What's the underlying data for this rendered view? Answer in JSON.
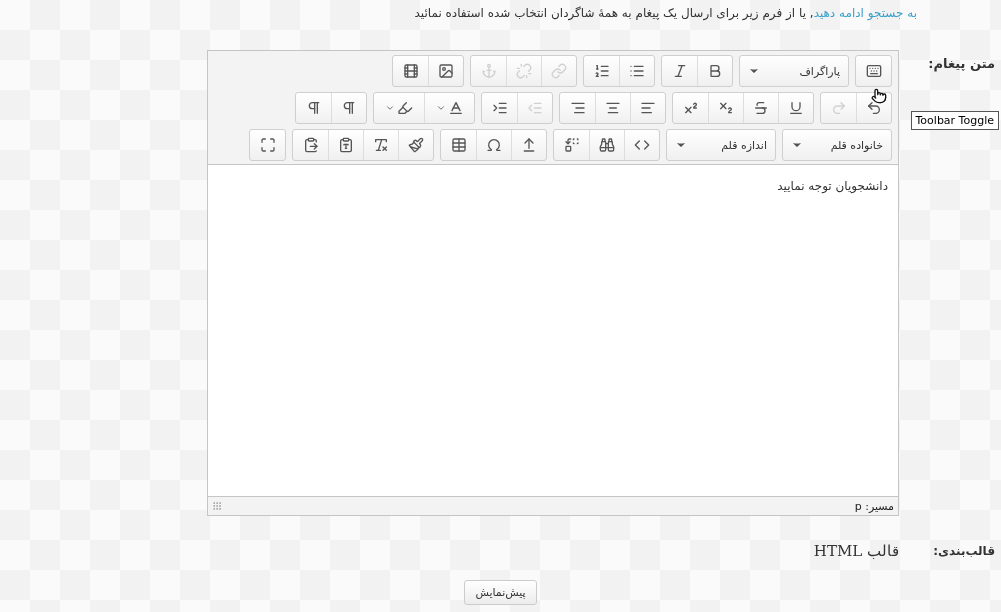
{
  "intro": {
    "link": "به جستجو ادامه دهید",
    "text": ", یا از فرم زیر برای ارسال یک پیغام به همهٔ شاگردان انتخاب شده استفاده نمائید"
  },
  "message_label": "متن پیغام:",
  "toolbar": {
    "rows": [
      {
        "items": [
          {
            "kind": "group",
            "buttons": [
              {
                "kind": "toggle",
                "disabled": false
              }
            ]
          },
          {
            "kind": "select",
            "value": "پاراگراف"
          },
          {
            "kind": "group",
            "buttons": [
              {
                "kind": "bold",
                "disabled": false
              },
              {
                "kind": "italic",
                "disabled": false
              }
            ]
          },
          {
            "kind": "group",
            "buttons": [
              {
                "kind": "bullet-list",
                "disabled": false
              },
              {
                "kind": "numbered-list",
                "disabled": false
              }
            ]
          },
          {
            "kind": "group",
            "buttons": [
              {
                "kind": "link",
                "disabled": true
              },
              {
                "kind": "unlink",
                "disabled": true
              },
              {
                "kind": "anchor",
                "disabled": true
              }
            ]
          },
          {
            "kind": "group",
            "buttons": [
              {
                "kind": "image",
                "disabled": false
              },
              {
                "kind": "media",
                "disabled": false
              }
            ]
          }
        ]
      },
      {
        "items": [
          {
            "kind": "group",
            "buttons": [
              {
                "kind": "undo",
                "disabled": false
              },
              {
                "kind": "redo",
                "disabled": true
              }
            ]
          },
          {
            "kind": "group",
            "buttons": [
              {
                "kind": "underline",
                "disabled": false
              },
              {
                "kind": "strikethrough",
                "disabled": false
              },
              {
                "kind": "subscript",
                "disabled": false
              },
              {
                "kind": "superscript",
                "disabled": false
              }
            ]
          },
          {
            "kind": "group",
            "buttons": [
              {
                "kind": "align-left",
                "disabled": false
              },
              {
                "kind": "align-center",
                "disabled": false
              },
              {
                "kind": "align-right",
                "disabled": false
              }
            ]
          },
          {
            "kind": "group",
            "buttons": [
              {
                "kind": "outdent",
                "disabled": true
              },
              {
                "kind": "indent",
                "disabled": false
              }
            ]
          },
          {
            "kind": "group",
            "buttons": [
              {
                "kind": "text-color",
                "disabled": false
              },
              {
                "kind": "highlight-color",
                "disabled": false
              }
            ]
          },
          {
            "kind": "group",
            "buttons": [
              {
                "kind": "ltr",
                "disabled": false
              },
              {
                "kind": "rtl",
                "disabled": false
              }
            ]
          }
        ]
      },
      {
        "items": [
          {
            "kind": "select",
            "value": "خانواده قلم"
          },
          {
            "kind": "select",
            "value": "اندازه قلم"
          },
          {
            "kind": "group",
            "buttons": [
              {
                "kind": "code",
                "disabled": false
              },
              {
                "kind": "find",
                "disabled": false
              },
              {
                "kind": "replace",
                "disabled": false
              }
            ]
          },
          {
            "kind": "group",
            "buttons": [
              {
                "kind": "insert",
                "disabled": false
              },
              {
                "kind": "special-character",
                "disabled": false
              },
              {
                "kind": "table",
                "disabled": false
              }
            ]
          },
          {
            "kind": "group",
            "buttons": [
              {
                "kind": "clear-format",
                "disabled": false
              },
              {
                "kind": "remove-formatting",
                "disabled": false
              },
              {
                "kind": "paste-text",
                "disabled": false
              },
              {
                "kind": "paste-word",
                "disabled": false
              }
            ]
          },
          {
            "kind": "group",
            "buttons": [
              {
                "kind": "fullscreen",
                "disabled": false
              }
            ]
          }
        ]
      }
    ]
  },
  "tooltip": "Toolbar Toggle",
  "content": "دانشجویان توجه نمایید",
  "status": "مسیر: p",
  "format": {
    "label": "قالب‌بندی:",
    "value": "قالب HTML"
  },
  "preview_button": "پیش‌نمایش"
}
